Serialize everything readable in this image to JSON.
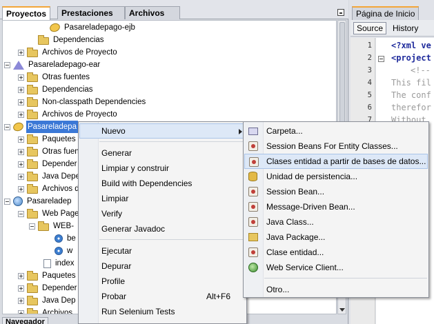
{
  "left_panel": {
    "tabs": [
      "Proyectos",
      "Prestaciones",
      "Archivos"
    ],
    "active_tab": "Proyectos",
    "tree": [
      {
        "label": "Pasareladepago-ejb",
        "icon": "project-icon",
        "toggle": "none"
      },
      {
        "label": "Dependencias",
        "icon": "folder-icon",
        "toggle": "none"
      },
      {
        "label": "Archivos de Proyecto",
        "icon": "folder-icon",
        "toggle": "plus"
      },
      {
        "label": "Pasareladepago-ear",
        "icon": "ear-project-icon",
        "toggle": "minus"
      },
      {
        "label": "Otras fuentes",
        "icon": "folder-icon",
        "toggle": "plus"
      },
      {
        "label": "Dependencias",
        "icon": "folder-icon",
        "toggle": "plus"
      },
      {
        "label": "Non-classpath Dependencies",
        "icon": "folder-icon",
        "toggle": "plus"
      },
      {
        "label": "Archivos de Proyecto",
        "icon": "folder-icon",
        "toggle": "plus"
      },
      {
        "label": "Pasareladepa",
        "icon": "project-icon",
        "toggle": "minus",
        "selected": true
      },
      {
        "label": "Paquetes",
        "icon": "folder-icon",
        "toggle": "plus"
      },
      {
        "label": "Otras fuent",
        "icon": "folder-icon",
        "toggle": "plus"
      },
      {
        "label": "Depender",
        "icon": "folder-icon",
        "toggle": "plus"
      },
      {
        "label": "Java Depe",
        "icon": "folder-icon",
        "toggle": "plus"
      },
      {
        "label": "Archivos d",
        "icon": "folder-icon",
        "toggle": "plus"
      },
      {
        "label": "Pasareladep",
        "icon": "web-project-icon",
        "toggle": "minus"
      },
      {
        "label": "Web Page",
        "icon": "folder-icon",
        "toggle": "minus"
      },
      {
        "label": "WEB-",
        "icon": "folder-icon",
        "toggle": "minus"
      },
      {
        "label": "be",
        "icon": "xml-file-icon",
        "toggle": "none"
      },
      {
        "label": "w",
        "icon": "xml-file-icon",
        "toggle": "none"
      },
      {
        "label": "index",
        "icon": "html-file-icon",
        "toggle": "none"
      },
      {
        "label": "Paquetes",
        "icon": "folder-icon",
        "toggle": "plus"
      },
      {
        "label": "Depender",
        "icon": "folder-icon",
        "toggle": "plus"
      },
      {
        "label": "Java Dep",
        "icon": "folder-icon",
        "toggle": "plus"
      },
      {
        "label": "Archivos",
        "icon": "folder-icon",
        "toggle": "plus"
      }
    ],
    "bottom_tab": "Navegador"
  },
  "editor": {
    "tab_title": "Página de Inicio",
    "toolbar": {
      "source": "Source",
      "history": "History"
    },
    "line_numbers": [
      "1",
      "2",
      "3",
      "4",
      "5",
      "6",
      "7"
    ],
    "code_lines": [
      "<?xml ve",
      "<project",
      "<!--",
      "This fil",
      "The conf",
      "therefor",
      "Without"
    ]
  },
  "context_menu": {
    "items": [
      {
        "label": "Nuevo",
        "submenu": true,
        "highlighted": true
      },
      {
        "label": "Generar"
      },
      {
        "label": "Limpiar y construir"
      },
      {
        "label": "Build with Dependencies"
      },
      {
        "label": "Limpiar"
      },
      {
        "label": "Verify"
      },
      {
        "label": "Generar Javadoc"
      },
      {
        "label": "Ejecutar"
      },
      {
        "label": "Depurar"
      },
      {
        "label": "Profile"
      },
      {
        "label": "Probar",
        "shortcut": "Alt+F6"
      },
      {
        "label": "Run Selenium Tests"
      }
    ]
  },
  "submenu": {
    "items": [
      {
        "label": "Carpeta...",
        "icon": "folder-icon"
      },
      {
        "label": "Session Beans For Entity Classes...",
        "icon": "bean-icon"
      },
      {
        "label": "Clases entidad a partir de bases de datos...",
        "icon": "bean-icon",
        "highlighted": true
      },
      {
        "label": "Unidad de persistencia...",
        "icon": "database-icon"
      },
      {
        "label": "Session Bean...",
        "icon": "bean-icon"
      },
      {
        "label": "Message-Driven Bean...",
        "icon": "bean-icon"
      },
      {
        "label": "Java Class...",
        "icon": "bean-icon"
      },
      {
        "label": "Java Package...",
        "icon": "package-icon"
      },
      {
        "label": "Clase entidad...",
        "icon": "bean-icon"
      },
      {
        "label": "Web Service Client...",
        "icon": "globe-icon"
      },
      {
        "label": "Otro...",
        "icon": ""
      }
    ]
  },
  "colors": {
    "selection": "#3b78d6",
    "menu_highlight": "#dde8f7",
    "tab_accent": "#f3a537"
  }
}
